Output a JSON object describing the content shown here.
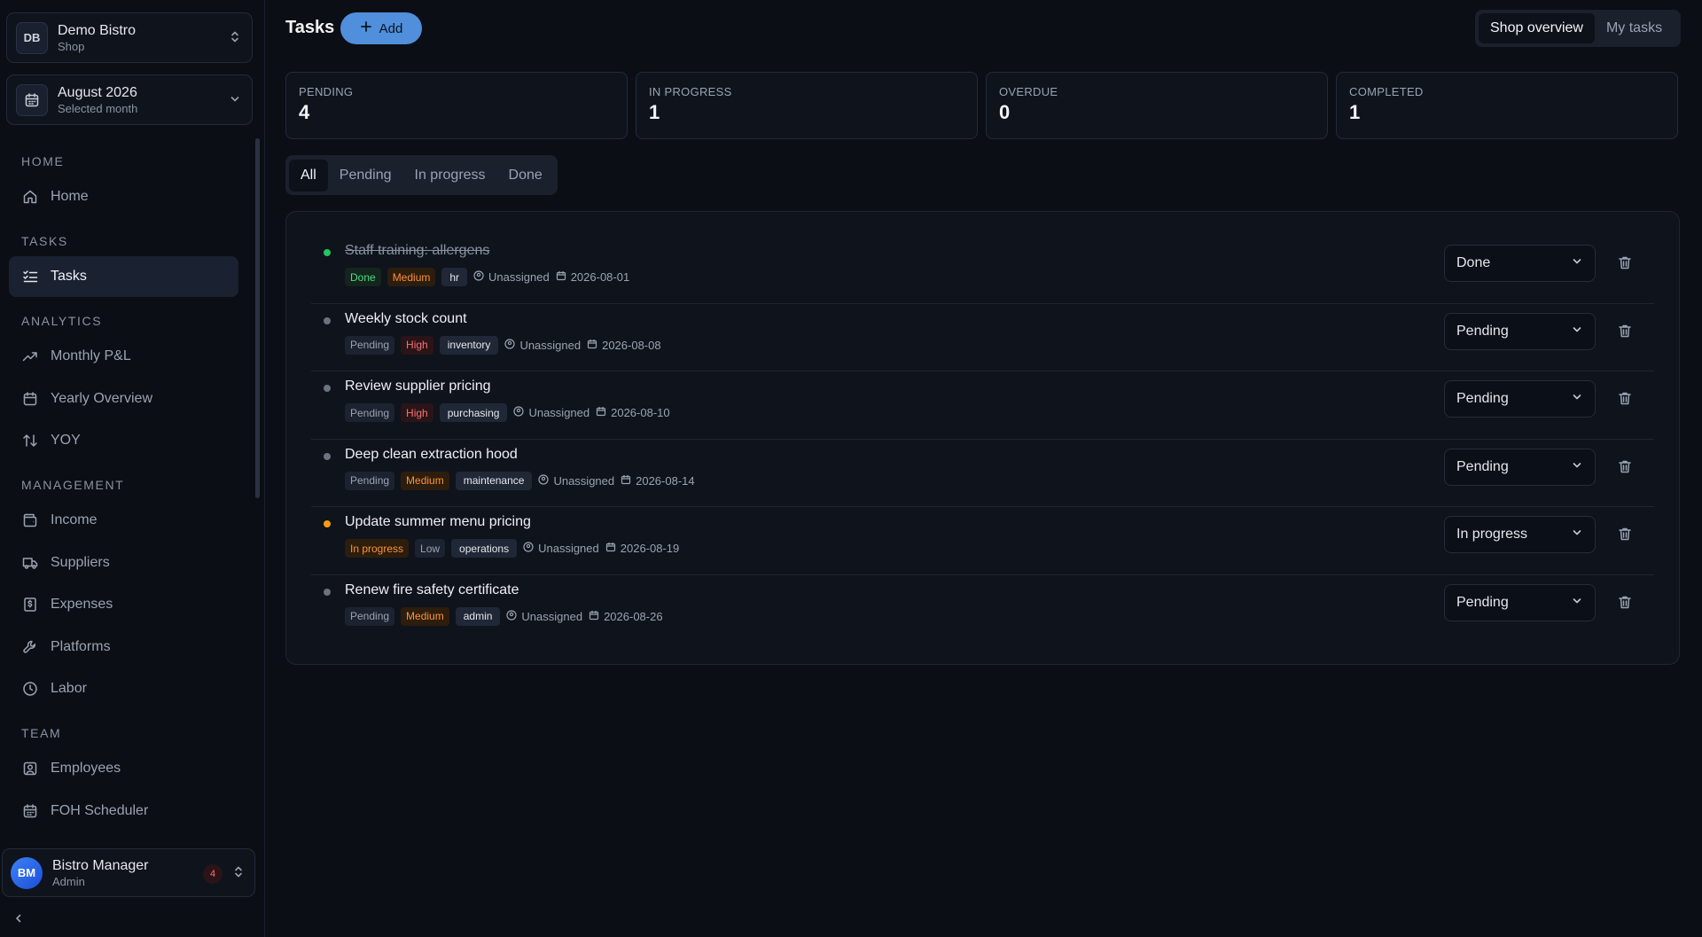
{
  "shop": {
    "initials": "DB",
    "name": "Demo Bistro",
    "type": "Shop"
  },
  "month": {
    "label": "August 2026",
    "sub": "Selected month"
  },
  "nav": {
    "home_section": "HOME",
    "home": "Home",
    "tasks_section": "TASKS",
    "tasks": "Tasks",
    "analytics_section": "ANALYTICS",
    "monthly_pl": "Monthly P&L",
    "yearly_overview": "Yearly Overview",
    "yoy": "YOY",
    "management_section": "MANAGEMENT",
    "income": "Income",
    "suppliers": "Suppliers",
    "expenses": "Expenses",
    "platforms": "Platforms",
    "labor": "Labor",
    "team_section": "TEAM",
    "employees": "Employees",
    "foh_scheduler": "FOH Scheduler"
  },
  "user": {
    "initials": "BM",
    "name": "Bistro Manager",
    "role": "Admin",
    "notifications": "4"
  },
  "header": {
    "title": "Tasks",
    "add_label": "Add",
    "view_shop": "Shop overview",
    "view_mine": "My tasks"
  },
  "stats": [
    {
      "label": "PENDING",
      "value": "4"
    },
    {
      "label": "IN PROGRESS",
      "value": "1"
    },
    {
      "label": "OVERDUE",
      "value": "0"
    },
    {
      "label": "COMPLETED",
      "value": "1"
    }
  ],
  "filters": [
    "All",
    "Pending",
    "In progress",
    "Done"
  ],
  "tasks": [
    {
      "title": "Staff training: allergens",
      "status": "Done",
      "priority": "Medium",
      "tag": "hr",
      "assignee": "Unassigned",
      "date": "2026-08-01",
      "select": "Done"
    },
    {
      "title": "Weekly stock count",
      "status": "Pending",
      "priority": "High",
      "tag": "inventory",
      "assignee": "Unassigned",
      "date": "2026-08-08",
      "select": "Pending"
    },
    {
      "title": "Review supplier pricing",
      "status": "Pending",
      "priority": "High",
      "tag": "purchasing",
      "assignee": "Unassigned",
      "date": "2026-08-10",
      "select": "Pending"
    },
    {
      "title": "Deep clean extraction hood",
      "status": "Pending",
      "priority": "Medium",
      "tag": "maintenance",
      "assignee": "Unassigned",
      "date": "2026-08-14",
      "select": "Pending"
    },
    {
      "title": "Update summer menu pricing",
      "status": "In progress",
      "priority": "Low",
      "tag": "operations",
      "assignee": "Unassigned",
      "date": "2026-08-19",
      "select": "In progress"
    },
    {
      "title": "Renew fire safety certificate",
      "status": "Pending",
      "priority": "Medium",
      "tag": "admin",
      "assignee": "Unassigned",
      "date": "2026-08-26",
      "select": "Pending"
    }
  ],
  "colors": {
    "accent": "#4f8fdb",
    "done": "#22c55e",
    "progress": "#f59e0b",
    "pending": "#6b7280"
  }
}
